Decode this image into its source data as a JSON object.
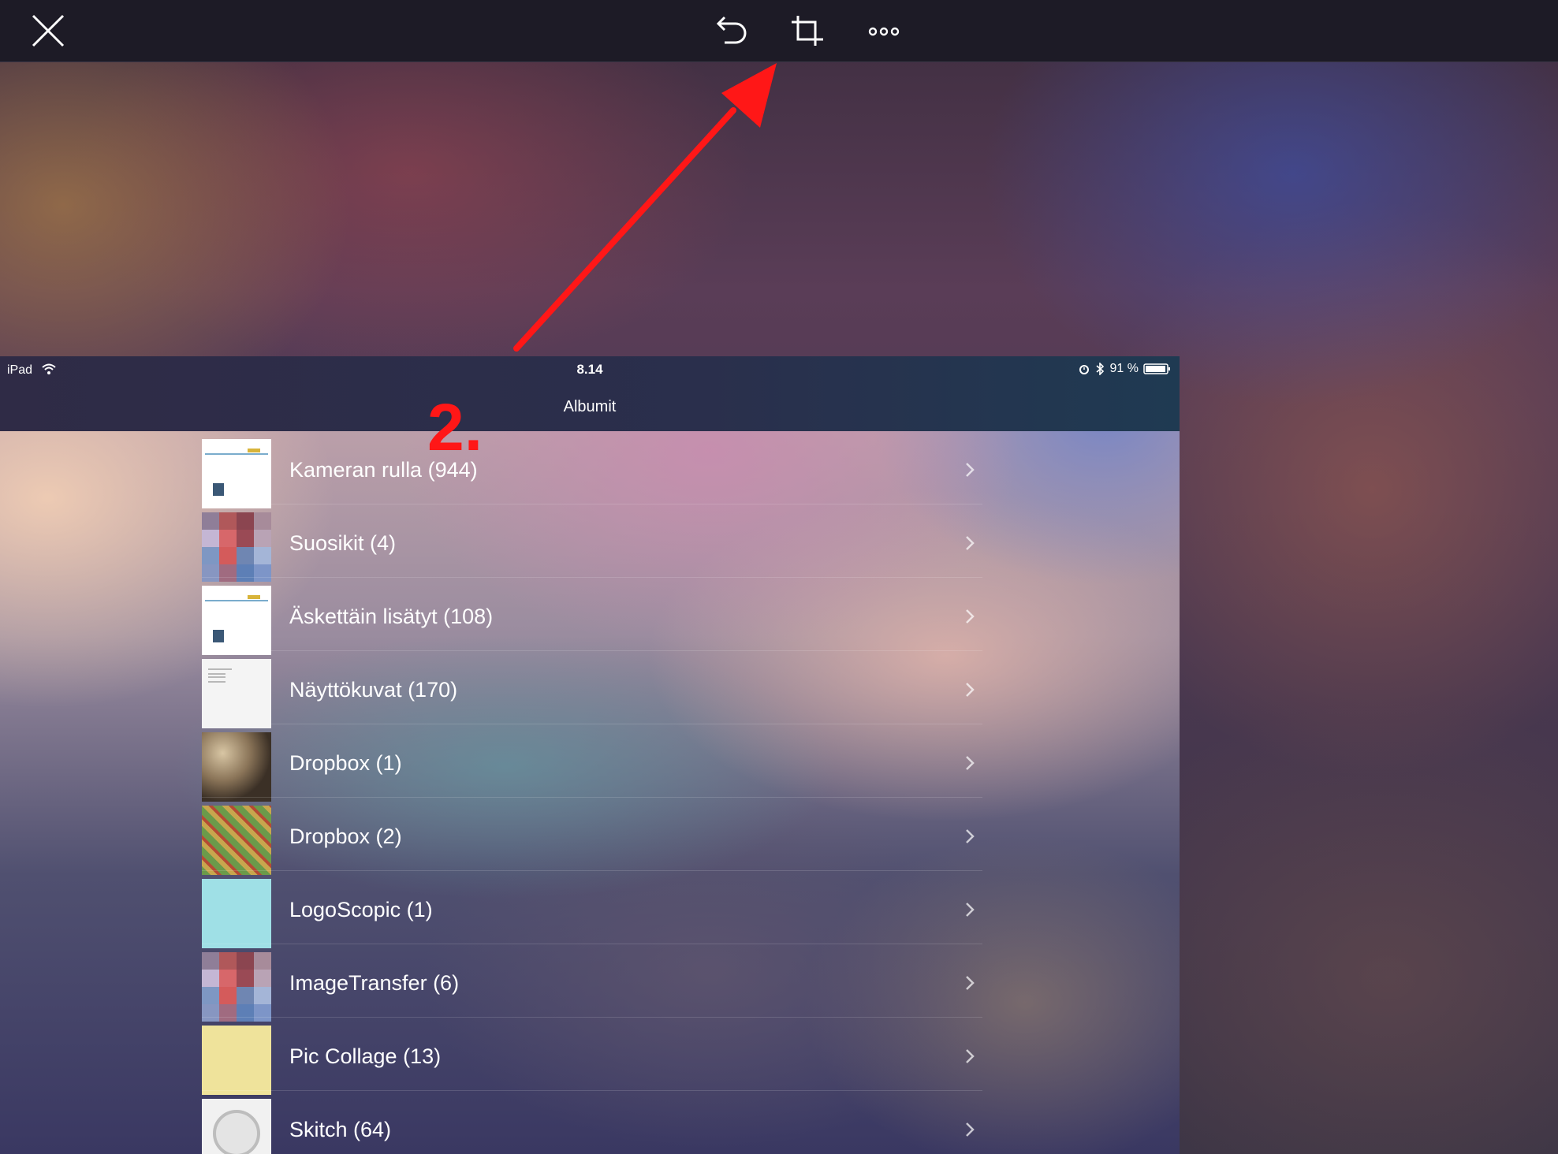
{
  "toolbar": {
    "buttons": [
      {
        "name": "close",
        "icon": "close-icon"
      },
      {
        "name": "undo",
        "icon": "undo-icon"
      },
      {
        "name": "crop",
        "icon": "crop-icon"
      },
      {
        "name": "more",
        "icon": "more-icon"
      }
    ]
  },
  "annotation": {
    "step_label": "2.",
    "arrow_color": "#ff1717"
  },
  "screenshot": {
    "status_bar": {
      "device": "iPad",
      "time": "8.14",
      "battery": "91 %",
      "icons": [
        "wifi-icon",
        "alarm-icon",
        "bluetooth-icon",
        "battery-icon"
      ]
    },
    "nav_title": "Albumit",
    "albums": [
      {
        "label": "Kameran rulla (944)",
        "thumb": "timeline"
      },
      {
        "label": "Suosikit (4)",
        "thumb": "mosaic"
      },
      {
        "label": "Äskettäin lisätyt (108)",
        "thumb": "timeline"
      },
      {
        "label": "Näyttökuvat (170)",
        "thumb": "document"
      },
      {
        "label": "Dropbox (1)",
        "thumb": "rocks"
      },
      {
        "label": "Dropbox (2)",
        "thumb": "map"
      },
      {
        "label": "LogoScopic (1)",
        "thumb": "logo"
      },
      {
        "label": "ImageTransfer (6)",
        "thumb": "mosaic"
      },
      {
        "label": "Pic Collage (13)",
        "thumb": "collage"
      },
      {
        "label": "Skitch (64)",
        "thumb": "clock"
      }
    ]
  },
  "colors": {
    "toolbar_bg": "#1d1b26",
    "nav_bg": "#2a2f4c",
    "text": "#ffffff",
    "accent": "#ff1717"
  }
}
